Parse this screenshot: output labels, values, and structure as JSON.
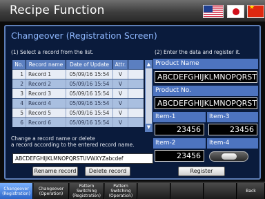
{
  "header": {
    "title": "Recipe Function",
    "languages": [
      "english-us-flag-icon",
      "japanese-flag-icon",
      "chinese-flag-icon"
    ]
  },
  "panel": {
    "heading": "Changeover (Registration Screen)",
    "step1": "(1) Select a record from the list.",
    "step2": "(2) Enter the data and register it.",
    "change_note_line1": "Change a record name or delete",
    "change_note_line2": " a record according to the entered record name."
  },
  "table": {
    "headers": [
      "No.",
      "Record name",
      "Date of Update",
      "Attr."
    ],
    "rows": [
      [
        "1",
        "Record 1",
        "05/09/16  15:54",
        "V"
      ],
      [
        "2",
        "Record 2",
        "05/09/16  15:54",
        "V"
      ],
      [
        "3",
        "Record 3",
        "05/09/16  15:54",
        "V"
      ],
      [
        "4",
        "Record 4",
        "05/09/16  15:54",
        "V"
      ],
      [
        "5",
        "Record 5",
        "05/09/16  15:54",
        "V"
      ],
      [
        "6",
        "Record 6",
        "05/09/16  15:54",
        "V"
      ]
    ],
    "scroll_up": "▲",
    "scroll_down": "▼"
  },
  "record_input": {
    "value": "ABCDEFGHIJKLMNOPQRSTUVWXYZabcdef"
  },
  "buttons": {
    "rename": "Rename record",
    "delete": "Delete record",
    "register": "Register"
  },
  "fields": {
    "product_name_label": "Product Name",
    "product_name_value": "ABCDEFGHIJKLMNOPQRST",
    "product_no_label": "Product No.",
    "product_no_value": "ABCDEFGHIJKLMNOPQRST",
    "item1_label": "Item-1",
    "item1_value": "23456",
    "item3_label": "Item-3",
    "item3_value": "23456",
    "item2_label": "Item-2",
    "item2_value": "23456",
    "item4_label": "Item-4"
  },
  "tabs": [
    [
      "Changeover",
      "(Registration)"
    ],
    [
      "Changeover",
      "(Operation)"
    ],
    [
      "Pattern",
      "Switching",
      "(Registration)"
    ],
    [
      "Pattern",
      "Switching",
      "(Operation)"
    ],
    [
      "Back"
    ]
  ],
  "colors": {
    "panel_bg": "#0a1b3c",
    "heading": "#8fb8ff",
    "label_blue": "#4d74c0",
    "active_tab": "#2c65c7"
  }
}
